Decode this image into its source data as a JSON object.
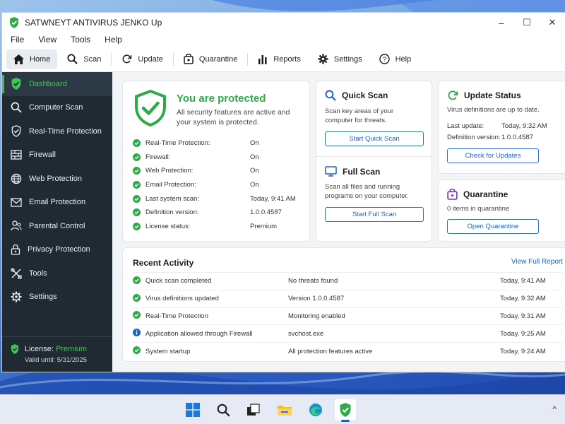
{
  "window": {
    "title": "SATWNEYT ANTIVIRUS JENKO Up",
    "controls": [
      "–",
      "☐",
      "✕"
    ]
  },
  "menu": [
    "File",
    "View",
    "Tools",
    "Help"
  ],
  "toolbar": [
    {
      "label": "Home",
      "icon": "home-icon",
      "active": true
    },
    {
      "label": "Scan",
      "icon": "search-icon"
    },
    {
      "label": "Update",
      "icon": "refresh-icon"
    },
    {
      "label": "Quarantine",
      "icon": "quarantine-icon"
    },
    {
      "label": "Reports",
      "icon": "bar-chart-icon"
    },
    {
      "label": "Settings",
      "icon": "gear-icon"
    },
    {
      "label": "Help",
      "icon": "help-icon"
    }
  ],
  "sidebar": {
    "items": [
      {
        "label": "Dashboard",
        "icon": "shield-check-icon",
        "active": true
      },
      {
        "label": "Computer Scan",
        "icon": "search-icon"
      },
      {
        "label": "Real-Time Protection",
        "icon": "shield-check-icon"
      },
      {
        "label": "Firewall",
        "icon": "firewall-icon"
      },
      {
        "label": "Web Protection",
        "icon": "globe-icon"
      },
      {
        "label": "Email Protection",
        "icon": "mail-icon"
      },
      {
        "label": "Parental Control",
        "icon": "users-icon"
      },
      {
        "label": "Privacy Protection",
        "icon": "lock-icon"
      },
      {
        "label": "Tools",
        "icon": "tools-icon"
      },
      {
        "label": "Settings",
        "icon": "gear-icon"
      }
    ],
    "license": {
      "label": "License:",
      "value": "Premium",
      "valid": "Valid until: 5/31/2025"
    }
  },
  "protection": {
    "title": "You are protected",
    "desc": "All security features are active and your system is protected.",
    "rows": [
      {
        "label": "Real-Time Protection:",
        "value": "On"
      },
      {
        "label": "Firewall:",
        "value": "On"
      },
      {
        "label": "Web Protection:",
        "value": "On"
      },
      {
        "label": "Email Protection:",
        "value": "On"
      },
      {
        "label": "Last system scan:",
        "value": "Today, 9:41 AM"
      },
      {
        "label": "Definition version:",
        "value": "1.0.0.4587"
      },
      {
        "label": "License status:",
        "value": "Premium"
      }
    ]
  },
  "quick_scan": {
    "title": "Quick Scan",
    "desc": "Scan key areas of your computer for threats.",
    "button": "Start Quick Scan"
  },
  "full_scan": {
    "title": "Full Scan",
    "desc": "Scan all files and running programs on your computer.",
    "button": "Start Full Scan"
  },
  "update_status": {
    "title": "Update Status",
    "desc": "Virus definitions are up to date.",
    "last_update_label": "Last update:",
    "last_update_value": "Today, 9:32 AM",
    "def_label": "Definition version:",
    "def_value": "1.0.0.4587",
    "button": "Check for Updates"
  },
  "quarantine": {
    "title": "Quarantine",
    "desc": "0 items in quarantine",
    "button": "Open Quarantine"
  },
  "activity": {
    "title": "Recent Activity",
    "link": "View Full Report",
    "rows": [
      {
        "icon": "check",
        "event": "Quick scan completed",
        "detail": "No threats found",
        "time": "Today, 9:41 AM"
      },
      {
        "icon": "check",
        "event": "Virus definitions updated",
        "detail": "Version 1.0.0.4587",
        "time": "Today, 9:32 AM"
      },
      {
        "icon": "check",
        "event": "Real-Time Protection",
        "detail": "Monitoring enabled",
        "time": "Today, 9:31 AM"
      },
      {
        "icon": "info",
        "event": "Application allowed through Firewall",
        "detail": "svchost.exe",
        "time": "Today, 9:25 AM"
      },
      {
        "icon": "check",
        "event": "System startup",
        "detail": "All protection features active",
        "time": "Today, 9:24 AM"
      }
    ]
  },
  "taskbar": {
    "icons": [
      "windows-start-icon",
      "search-icon",
      "task-view-icon",
      "file-explorer-icon",
      "edge-browser-icon",
      "antivirus-app-icon"
    ],
    "tray": "^"
  },
  "colors": {
    "accent_green": "#3ec653",
    "link_blue": "#1f5fcc",
    "sidebar_bg": "#1f2a33"
  }
}
